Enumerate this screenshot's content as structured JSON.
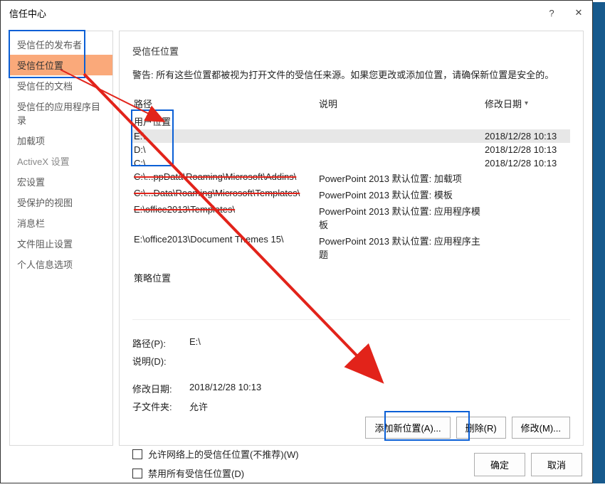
{
  "title": "信任中心",
  "sidebar": {
    "items": [
      {
        "label": "受信任的发布者"
      },
      {
        "label": "受信任位置"
      },
      {
        "label": "受信任的文档"
      },
      {
        "label": "受信任的应用程序目录"
      },
      {
        "label": "加载项"
      },
      {
        "label": "ActiveX 设置"
      },
      {
        "label": "宏设置"
      },
      {
        "label": "受保护的视图"
      },
      {
        "label": "消息栏"
      },
      {
        "label": "文件阻止设置"
      },
      {
        "label": "个人信息选项"
      }
    ]
  },
  "main": {
    "section_title": "受信任位置",
    "warning": "警告: 所有这些位置都被视为打开文件的受信任来源。如果您更改或添加位置，请确保新位置是安全的。",
    "headers": {
      "path": "路径",
      "desc": "说明",
      "date": "修改日期"
    },
    "group_user": "用户位置",
    "group_policy": "策略位置",
    "rows": [
      {
        "path": "E:\\",
        "desc": "",
        "date": "2018/12/28 10:13",
        "sel": true
      },
      {
        "path": "D:\\",
        "desc": "",
        "date": "2018/12/28 10:13"
      },
      {
        "path": "C:\\",
        "desc": "",
        "date": "2018/12/28 10:13"
      },
      {
        "path": "C:\\...ppData\\Roaming\\Microsoft\\Addins\\",
        "desc": "PowerPoint 2013 默认位置: 加载项",
        "date": ""
      },
      {
        "path": "C:\\...Data\\Roaming\\Microsoft\\Templates\\",
        "desc": "PowerPoint 2013 默认位置: 模板",
        "date": ""
      },
      {
        "path": "E:\\office2013\\Templates\\",
        "desc": "PowerPoint 2013 默认位置: 应用程序模板",
        "date": ""
      },
      {
        "path": "E:\\office2013\\Document Themes 15\\",
        "desc": "PowerPoint 2013 默认位置: 应用程序主题",
        "date": ""
      }
    ],
    "details": {
      "path_k": "路径(P):",
      "path_v": "E:\\",
      "desc_k": "说明(D):",
      "desc_v": "",
      "date_k": "修改日期:",
      "date_v": "2018/12/28 10:13",
      "sub_k": "子文件夹:",
      "sub_v": "允许"
    },
    "buttons": {
      "add": "添加新位置(A)...",
      "remove": "删除(R)",
      "modify": "修改(M)..."
    },
    "checks": {
      "net": "允许网络上的受信任位置(不推荐)(W)",
      "disable": "禁用所有受信任位置(D)"
    }
  },
  "footer": {
    "ok": "确定",
    "cancel": "取消"
  }
}
